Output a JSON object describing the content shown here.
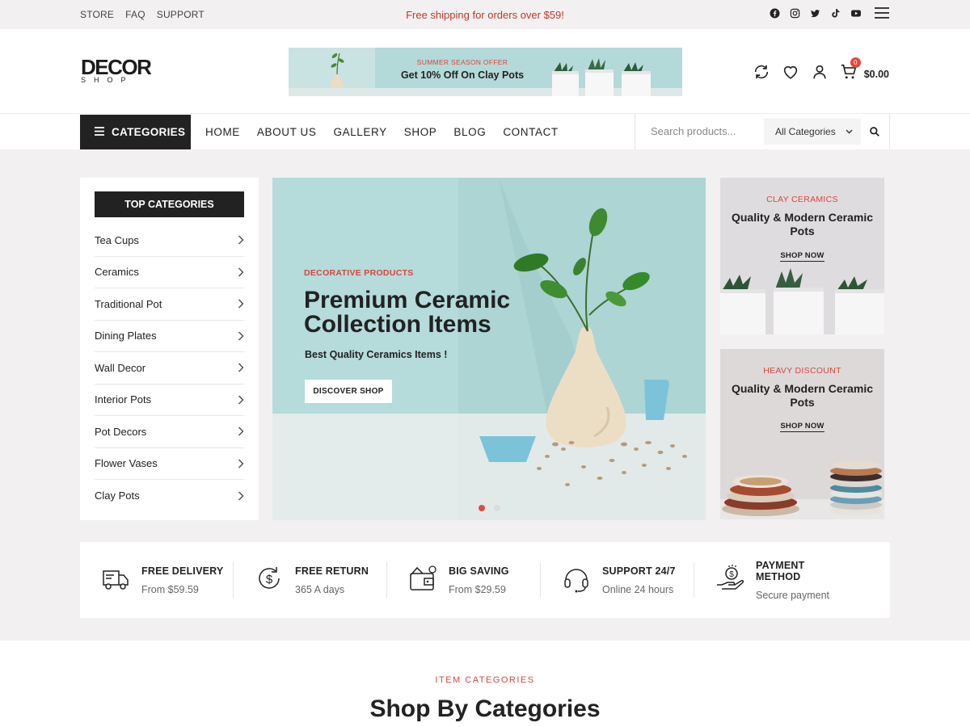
{
  "topbar": {
    "links": [
      "STORE",
      "FAQ",
      "SUPPORT"
    ],
    "promo": "Free shipping for orders over $59!",
    "socials": [
      "facebook-icon",
      "instagram-icon",
      "twitter-icon",
      "tiktok-icon",
      "youtube-icon",
      "menu-icon"
    ]
  },
  "header": {
    "logo_main": "DECOR",
    "logo_sub": "SHOP",
    "banner_small": "SUMMER SEASON OFFER",
    "banner_big": "Get 10% Off On Clay Pots",
    "cart_count": "0",
    "cart_total": "$0.00"
  },
  "nav": {
    "categories_label": "CATEGORIES",
    "menu": [
      "HOME",
      "ABOUT US",
      "GALLERY",
      "SHOP",
      "BLOG",
      "CONTACT"
    ],
    "search_placeholder": "Search products...",
    "search_category": "All Categories"
  },
  "sidebar": {
    "title": "TOP CATEGORIES",
    "items": [
      "Tea Cups",
      "Ceramics",
      "Traditional Pot",
      "Dining Plates",
      "Wall Decor",
      "Interior Pots",
      "Pot Decors",
      "Flower Vases",
      "Clay Pots"
    ]
  },
  "hero": {
    "tag": "DECORATIVE PRODUCTS",
    "title": "Premium Ceramic Collection Items",
    "subtitle": "Best Quality Ceramics Items !",
    "button": "DISCOVER SHOP",
    "slides": 2,
    "active_slide": 1
  },
  "cards": [
    {
      "tag": "CLAY CERAMICS",
      "title": "Quality & Modern Ceramic Pots",
      "link": "SHOP NOW"
    },
    {
      "tag": "HEAVY DISCOUNT",
      "title": "Quality & Modern Ceramic Pots",
      "link": "SHOP NOW"
    }
  ],
  "features": [
    {
      "icon": "truck-icon",
      "title": "FREE DELIVERY",
      "sub": "From $59.59"
    },
    {
      "icon": "return-dollar-icon",
      "title": "FREE RETURN",
      "sub": "365 A days"
    },
    {
      "icon": "wallet-icon",
      "title": "BIG SAVING",
      "sub": "From $29.59"
    },
    {
      "icon": "headset-icon",
      "title": "SUPPORT 24/7",
      "sub": "Online 24 hours"
    },
    {
      "icon": "payment-hand-icon",
      "title": "PAYMENT METHOD",
      "sub": "Secure payment"
    }
  ],
  "section": {
    "tag": "ITEM CATEGORIES",
    "title": "Shop By Categories"
  },
  "colors": {
    "accent": "#e8473b",
    "dark": "#222222",
    "background_grey": "#f2f0f1",
    "hero_bg": "#b5dbdb"
  }
}
